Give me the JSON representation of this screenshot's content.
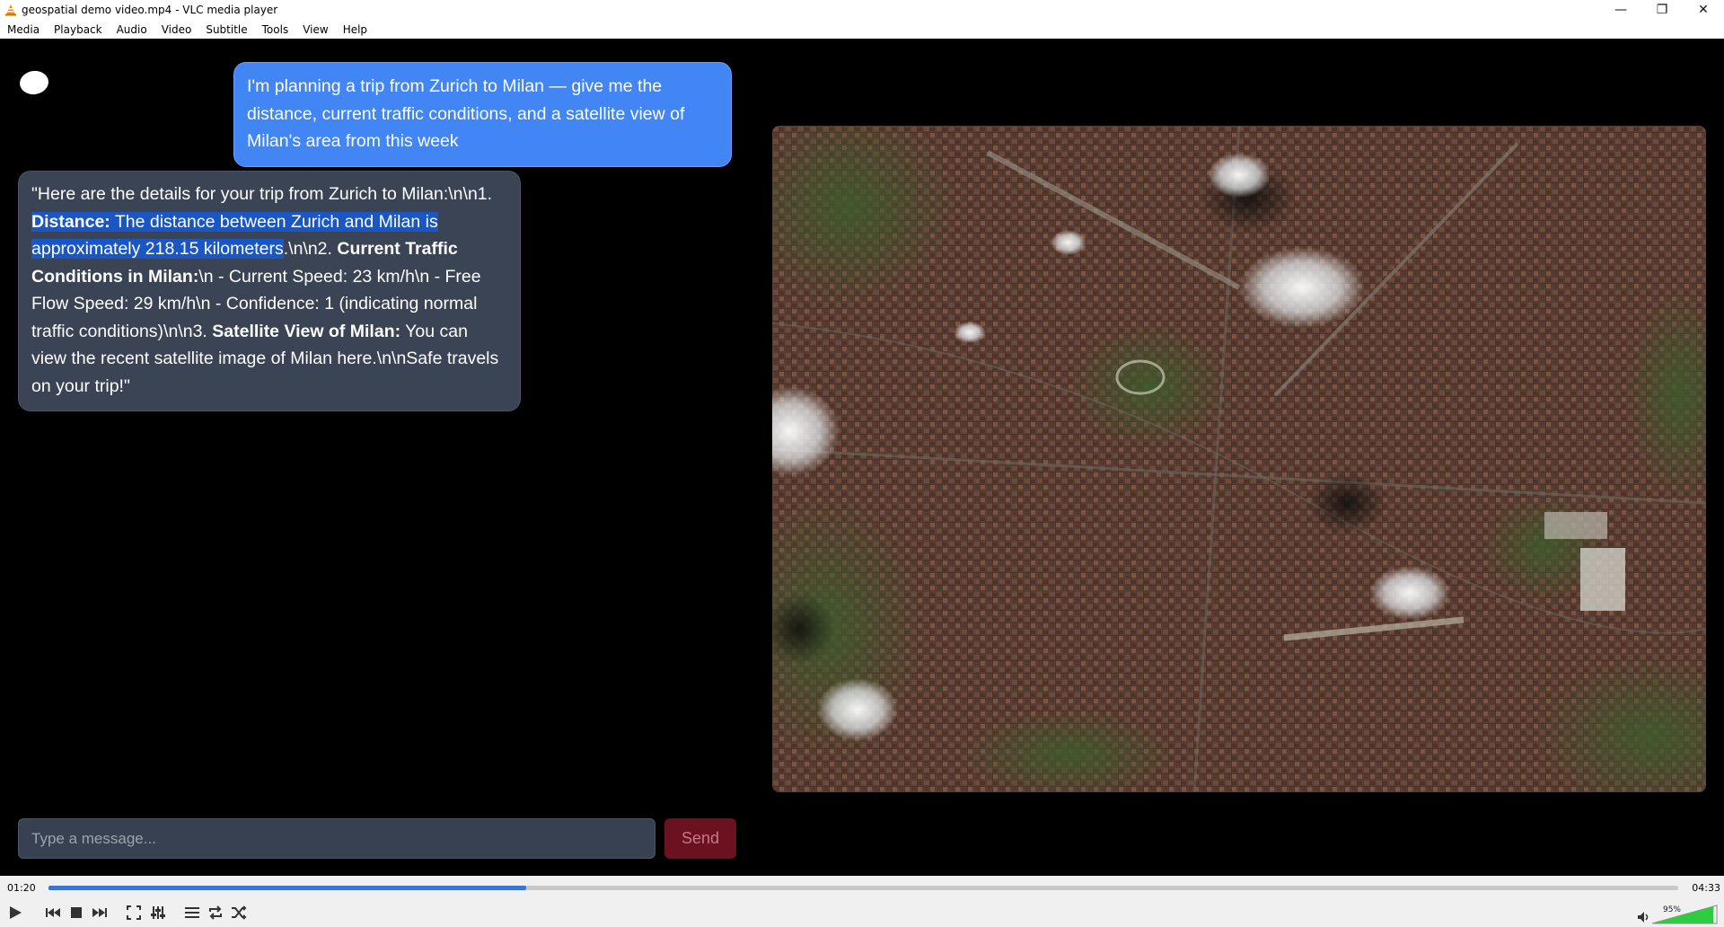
{
  "window": {
    "title": "geospatial demo video.mp4 - VLC media player",
    "minimize_glyph": "—",
    "maximize_glyph": "❐",
    "close_glyph": "✕"
  },
  "menu": [
    "Media",
    "Playback",
    "Audio",
    "Video",
    "Subtitle",
    "Tools",
    "View",
    "Help"
  ],
  "chat": {
    "user_message": "I'm planning a trip from Zurich to Milan — give me the distance, current traffic conditions, and a satellite view of Milan's area from this week",
    "bot": {
      "p1": "\"Here are the details for your trip from Zurich to Milan:\\n\\n1. ",
      "b1": "Distance:",
      "p2": " The distance between Zurich and Milan is approximately 218.15 kilometers",
      "p3": ".\\n\\n2. ",
      "b2": "Current Traffic Conditions in Milan:",
      "p4": "\\n - Current Speed: 23 km/h\\n - Free Flow Speed: 29 km/h\\n - Confidence: 1 (indicating normal traffic conditions)\\n\\n3. ",
      "b3": "Satellite View of Milan:",
      "p5": " You can view the recent satellite image of Milan here.\\n\\nSafe travels on your trip!\""
    },
    "input_placeholder": "Type a message...",
    "send_label": "Send"
  },
  "player": {
    "current_time": "01:20",
    "total_time": "04:33",
    "progress": 0.293,
    "volume_label": "95%",
    "volume": 0.95
  },
  "colors": {
    "user_bubble": "#4285f4",
    "bot_bubble": "#3a4454",
    "send_button": "#6b1120",
    "seek_fill": "#3a74d4",
    "volume_fill": "#2ecc40"
  }
}
